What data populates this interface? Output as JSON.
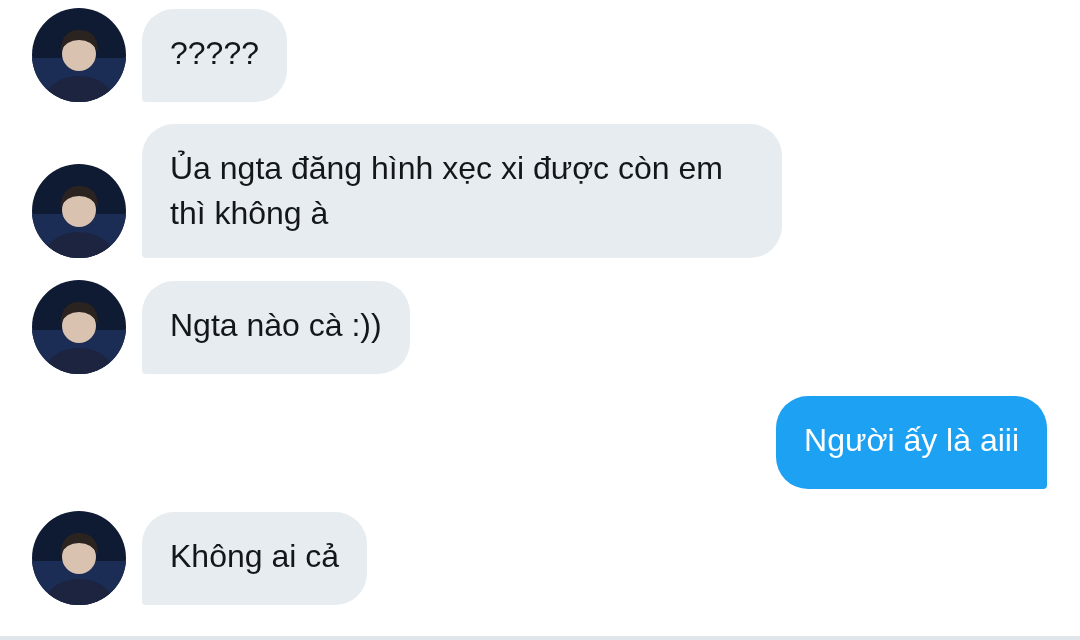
{
  "messages": [
    {
      "kind": "incoming",
      "text": "?????"
    },
    {
      "kind": "incoming",
      "text": "Ủa ngta đăng hình xẹc xi được còn em thì không à"
    },
    {
      "kind": "incoming",
      "text": "Ngta nào cà :))"
    },
    {
      "kind": "outgoing",
      "text": "Người ấy là aiii"
    },
    {
      "kind": "incoming",
      "text": "Không ai cả"
    }
  ]
}
